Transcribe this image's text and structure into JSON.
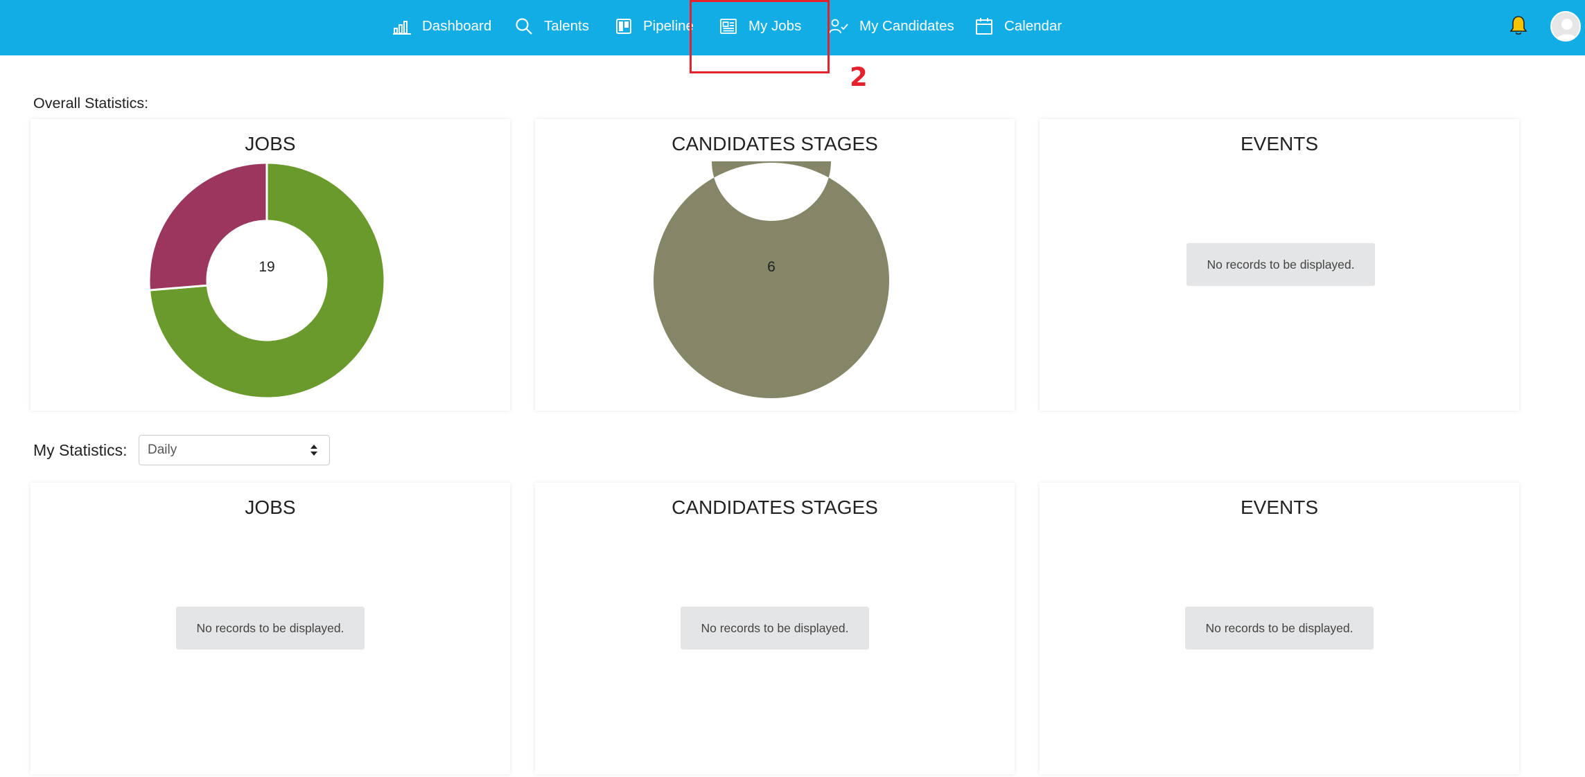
{
  "nav": {
    "items": [
      {
        "label": "Dashboard",
        "icon": "bar-chart-icon"
      },
      {
        "label": "Talents",
        "icon": "search-icon"
      },
      {
        "label": "Pipeline",
        "icon": "kanban-icon"
      },
      {
        "label": "My Jobs",
        "icon": "newspaper-icon"
      },
      {
        "label": "My Candidates",
        "icon": "user-check-icon"
      },
      {
        "label": "Calendar",
        "icon": "calendar-icon"
      }
    ],
    "bell_icon": "bell-icon",
    "avatar_icon": "user-avatar-icon",
    "background_color": "#12ade5"
  },
  "annotation": {
    "number": "2",
    "color": "#e5212b"
  },
  "overall": {
    "label": "Overall Statistics:",
    "cards": [
      {
        "title": "JOBS",
        "center": "19"
      },
      {
        "title": "CANDIDATES STAGES",
        "center": "6"
      },
      {
        "title": "EVENTS",
        "empty": "No records to be displayed."
      }
    ]
  },
  "mystats": {
    "label": "My Statistics:",
    "period": "Daily",
    "cards": [
      {
        "title": "JOBS",
        "empty": "No records to be displayed."
      },
      {
        "title": "CANDIDATES STAGES",
        "empty": "No records to be displayed."
      },
      {
        "title": "EVENTS",
        "empty": "No records to be displayed."
      }
    ]
  },
  "chart_data": [
    {
      "type": "pie",
      "title": "JOBS",
      "center_label": "19",
      "values": [
        14,
        5
      ],
      "colors": [
        "#6a9a2b",
        "#9b375e"
      ]
    },
    {
      "type": "pie",
      "title": "CANDIDATES STAGES",
      "center_label": "6",
      "values": [
        6
      ],
      "colors": [
        "#858567"
      ]
    }
  ]
}
